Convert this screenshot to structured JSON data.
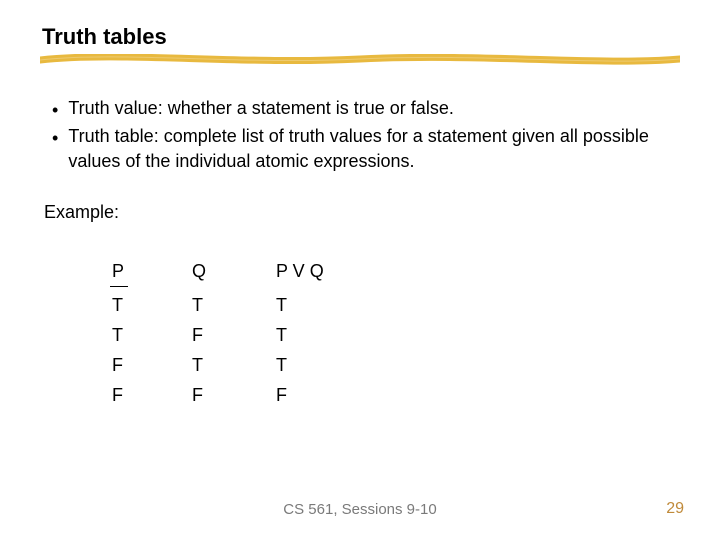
{
  "title": "Truth tables",
  "bullets": [
    "Truth value: whether a statement is true or false.",
    "Truth table: complete list of truth values for a statement given all possible values of the individual atomic expressions."
  ],
  "example_label": "Example:",
  "truth_table": {
    "headers": [
      "P",
      "Q",
      "P V Q"
    ],
    "rows": [
      [
        "T",
        "T",
        "T"
      ],
      [
        "T",
        "F",
        "T"
      ],
      [
        "F",
        "T",
        "T"
      ],
      [
        "F",
        "F",
        "F"
      ]
    ]
  },
  "footer": "CS 561,  Sessions 9-10",
  "page_number": "29"
}
